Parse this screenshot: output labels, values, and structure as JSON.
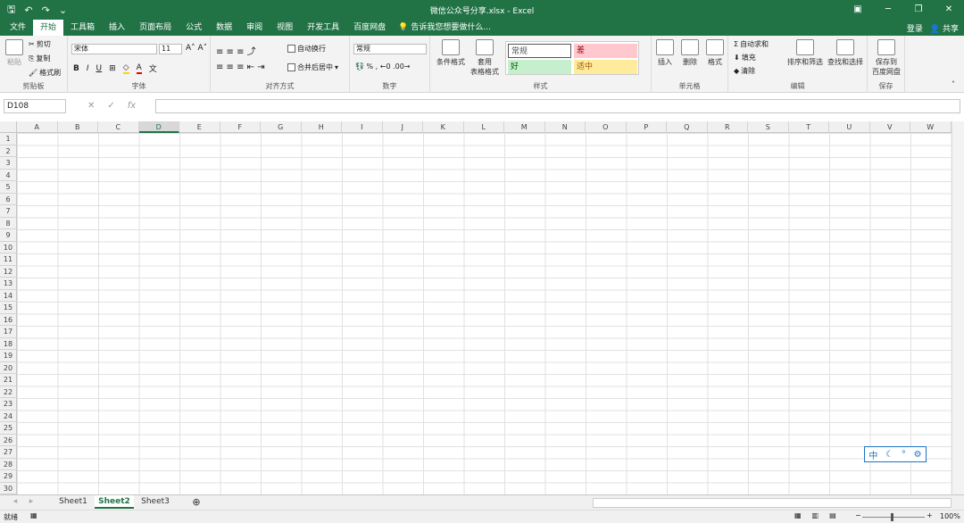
{
  "window": {
    "title": "微信公众号分享.xlsx - Excel"
  },
  "tabs": [
    "文件",
    "开始",
    "工具箱",
    "插入",
    "页面布局",
    "公式",
    "数据",
    "审阅",
    "视图",
    "开发工具",
    "百度网盘"
  ],
  "tell_me": "告诉我您想要做什么...",
  "account": {
    "login": "登录",
    "share": "共享"
  },
  "clipboard": {
    "paste": "粘贴",
    "cut": "剪切",
    "copy": "复制",
    "format_painter": "格式刷",
    "label": "剪贴板"
  },
  "font": {
    "name": "宋体",
    "size": "11",
    "label": "字体"
  },
  "alignment": {
    "wrap": "自动换行",
    "merge": "合并后居中",
    "label": "对齐方式"
  },
  "number": {
    "format": "常规",
    "label": "数字"
  },
  "styles": {
    "conditional": "条件格式",
    "table_line1": "套用",
    "table_line2": "表格格式",
    "normal": "常规",
    "bad": "差",
    "good": "好",
    "neutral": "适中",
    "label": "样式"
  },
  "cells": {
    "insert": "插入",
    "delete": "删除",
    "format": "格式",
    "label": "单元格"
  },
  "editing": {
    "autosum": "自动求和",
    "fill": "填充",
    "clear": "清除",
    "sort": "排序和筛选",
    "find": "查找和选择",
    "label": "编辑"
  },
  "save": {
    "line1": "保存到",
    "line2": "百度网盘",
    "label": "保存"
  },
  "formula_bar": {
    "name_box": "D108",
    "fx": "fx"
  },
  "columns": [
    "A",
    "B",
    "C",
    "D",
    "E",
    "F",
    "G",
    "H",
    "I",
    "J",
    "K",
    "L",
    "M",
    "N",
    "O",
    "P",
    "Q",
    "R",
    "S",
    "T",
    "U",
    "V",
    "W"
  ],
  "rows": [
    "1",
    "2",
    "3",
    "4",
    "5",
    "6",
    "7",
    "8",
    "9",
    "10",
    "11",
    "12",
    "13",
    "14",
    "15",
    "16",
    "17",
    "18",
    "19",
    "20",
    "21",
    "22",
    "23",
    "24",
    "25",
    "26",
    "27",
    "28",
    "29",
    "30"
  ],
  "selected_column": "D",
  "sheets": [
    "Sheet1",
    "Sheet2",
    "Sheet3"
  ],
  "active_sheet": "Sheet2",
  "ime": {
    "mode": "中"
  },
  "status": {
    "ready": "就绪",
    "zoom": "100%"
  },
  "colors": {
    "accent": "#217346",
    "bad_bg": "#ffc7ce",
    "good_bg": "#c6efce",
    "neutral_bg": "#ffeb9c"
  }
}
